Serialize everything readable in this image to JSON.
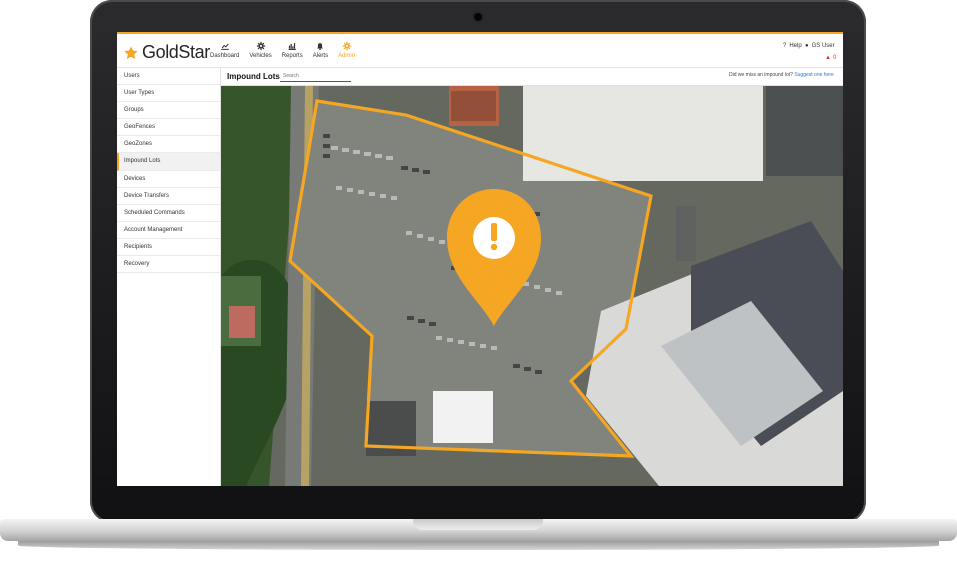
{
  "app": {
    "brand": "GoldStar"
  },
  "nav": [
    {
      "label": "Dashboard",
      "icon": "chart-icon",
      "active": false
    },
    {
      "label": "Vehicles",
      "icon": "gear-icon",
      "active": false
    },
    {
      "label": "Reports",
      "icon": "bar-chart-icon",
      "active": false
    },
    {
      "label": "Alerts",
      "icon": "bell-icon",
      "active": false
    },
    {
      "label": "Admin",
      "icon": "gear-icon",
      "active": true
    }
  ],
  "header": {
    "help": "Help",
    "user": "GS User",
    "alert_count": "0"
  },
  "sidebar": [
    {
      "label": "Users"
    },
    {
      "label": "User Types"
    },
    {
      "label": "Groups"
    },
    {
      "label": "GeoFences"
    },
    {
      "label": "GeoZones"
    },
    {
      "label": "Impound Lots",
      "active": true
    },
    {
      "label": "Devices"
    },
    {
      "label": "Device Transfers"
    },
    {
      "label": "Scheduled Commands"
    },
    {
      "label": "Account Management"
    },
    {
      "label": "Recipients"
    },
    {
      "label": "Recovery"
    }
  ],
  "main": {
    "title": "Impound Lots",
    "search_placeholder": "Search",
    "miss_prompt": "Did we miss an impound lot?",
    "suggest_link": "Suggest one here"
  },
  "map": {
    "marker_icon": "alert-marker-icon",
    "accent": "#f5a623"
  }
}
